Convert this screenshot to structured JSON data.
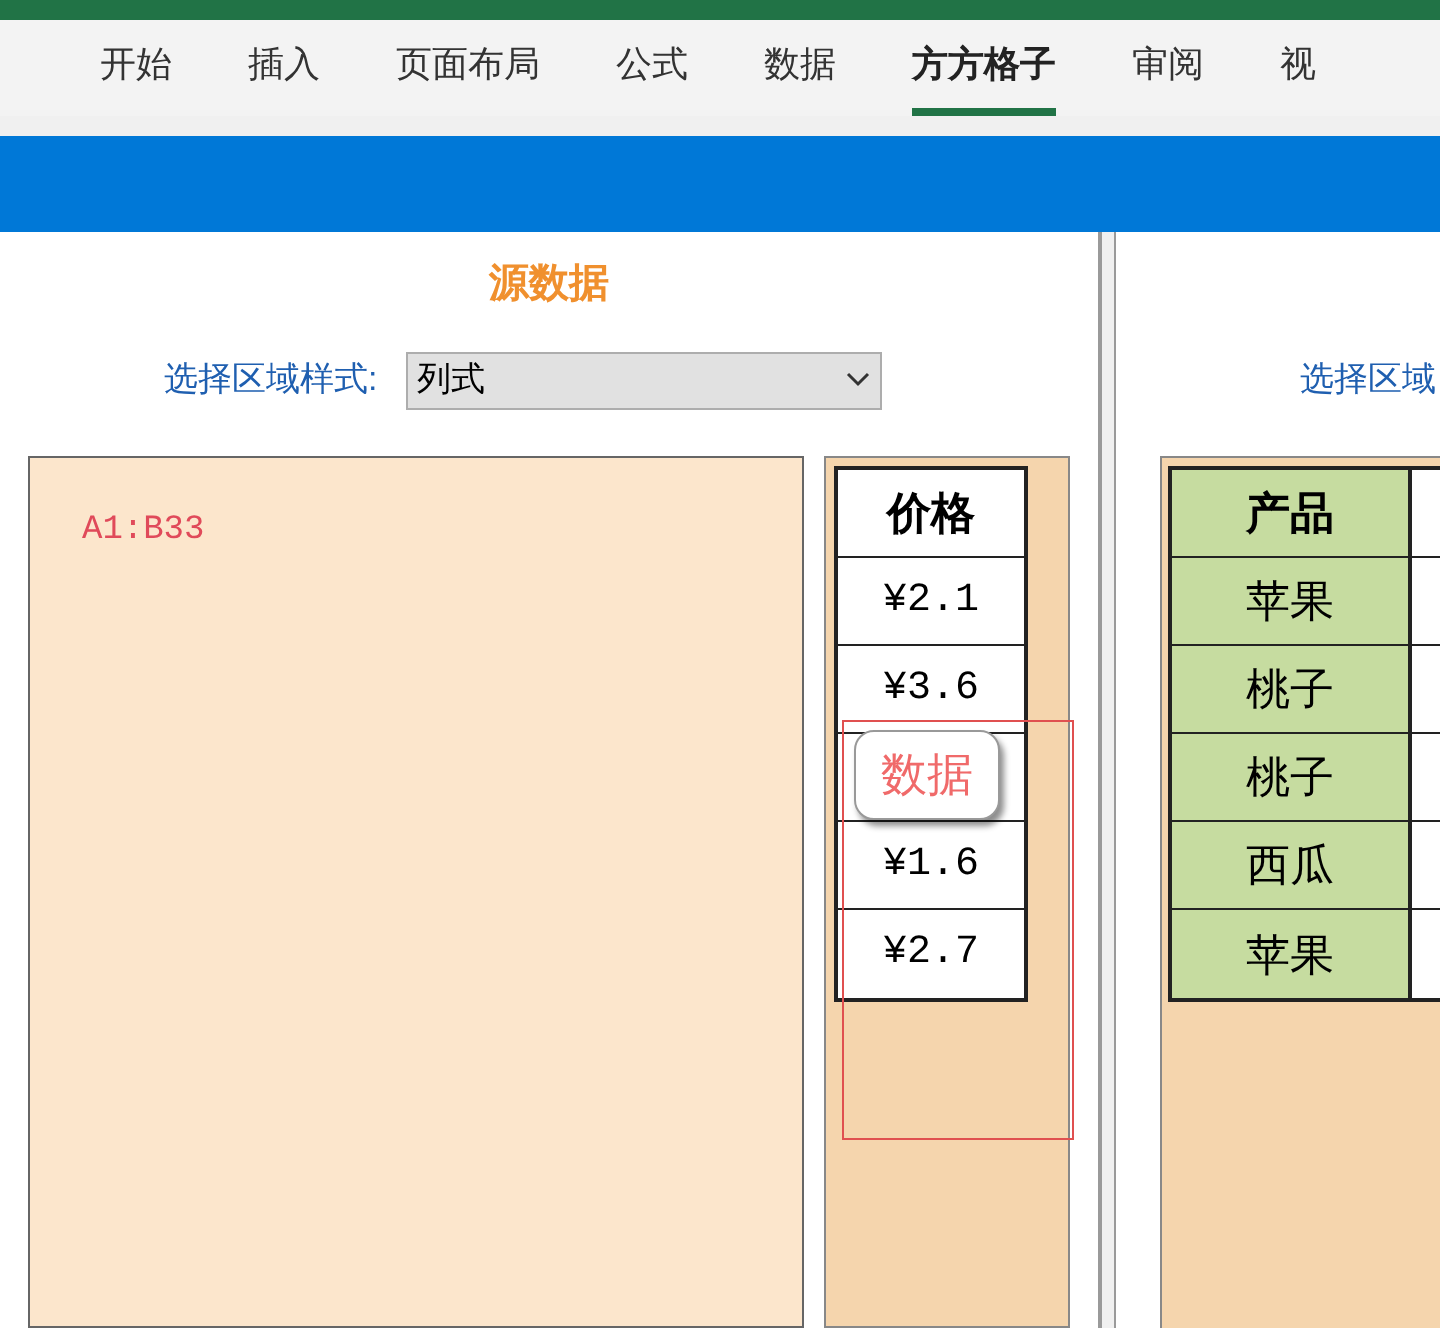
{
  "ribbon_tabs": [
    {
      "label": "开始",
      "selected": false
    },
    {
      "label": "插入",
      "selected": false
    },
    {
      "label": "页面布局",
      "selected": false
    },
    {
      "label": "公式",
      "selected": false
    },
    {
      "label": "数据",
      "selected": false
    },
    {
      "label": "方方格子",
      "selected": true
    },
    {
      "label": "审阅",
      "selected": false
    },
    {
      "label": "视",
      "selected": false
    }
  ],
  "left_panel": {
    "title": "源数据",
    "style_label": "选择区域样式:",
    "style_select": {
      "value": "列式"
    },
    "range_text": "A1:B33",
    "price_table": {
      "header": "价格",
      "rows": [
        {
          "kind": "price",
          "value": "¥2.1"
        },
        {
          "kind": "price",
          "value": "¥3.6"
        },
        {
          "kind": "badge",
          "value": "数据"
        },
        {
          "kind": "price",
          "value": "¥1.6"
        },
        {
          "kind": "price",
          "value": "¥2.7"
        }
      ]
    }
  },
  "right_panel": {
    "style_label": "选择区域",
    "product_table": {
      "header": "产品",
      "rows": [
        "苹果",
        "桃子",
        "桃子",
        "西瓜",
        "苹果"
      ]
    }
  }
}
